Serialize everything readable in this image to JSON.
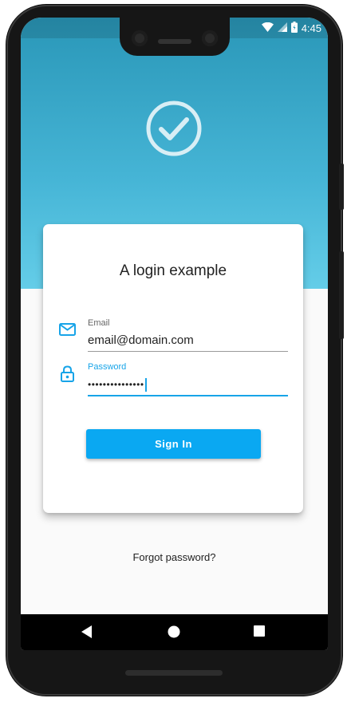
{
  "status_bar": {
    "time": "4:45",
    "icons": [
      "wifi-icon",
      "cellular-signal-icon",
      "battery-icon"
    ]
  },
  "logo": {
    "icon": "check-circle-icon"
  },
  "login_card": {
    "title": "A login example",
    "email": {
      "label": "Email",
      "value": "email@domain.com",
      "icon": "mail-icon"
    },
    "password": {
      "label": "Password",
      "value": "•••••••••••••••",
      "icon": "lock-icon"
    },
    "sign_in_label": "Sign In"
  },
  "forgot_password_label": "Forgot password?",
  "nav_bar": {
    "items": [
      "back-icon",
      "home-icon",
      "recent-apps-icon"
    ]
  },
  "colors": {
    "accent": "#0aa8f2",
    "hero_top": "#2a97b8",
    "hero_bottom": "#64cde8"
  }
}
